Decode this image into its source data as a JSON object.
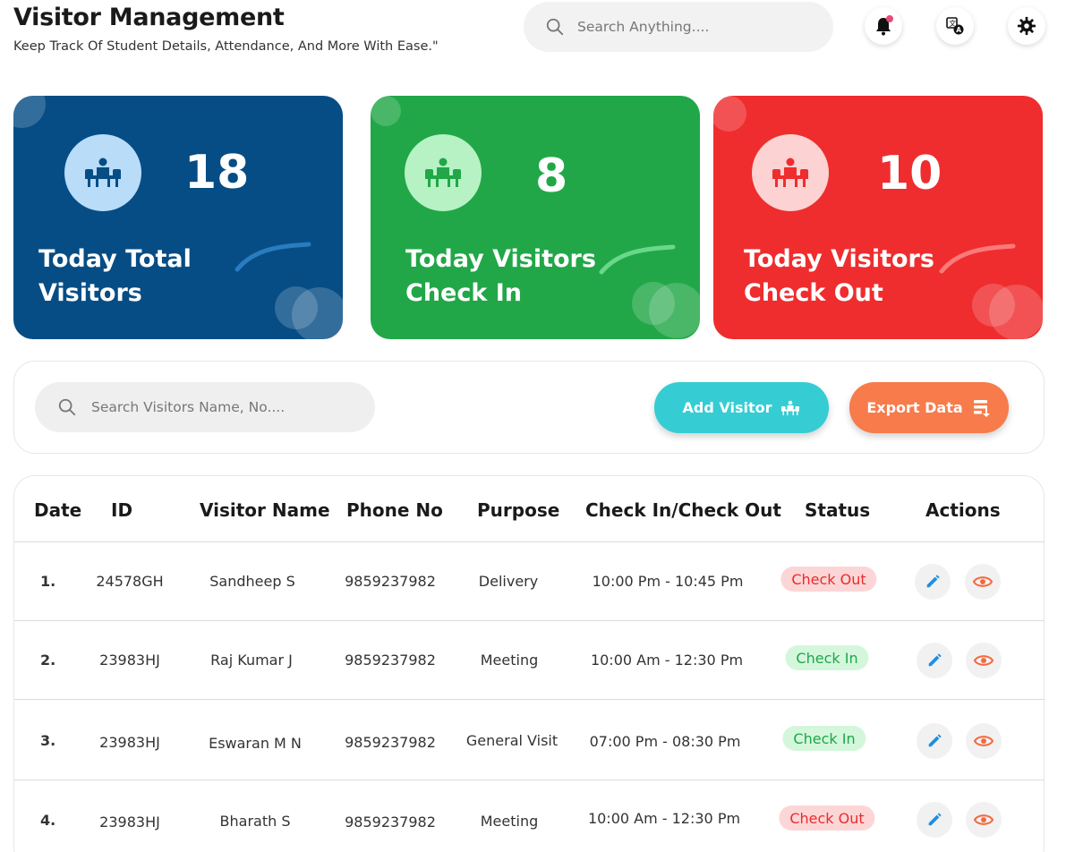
{
  "header": {
    "title": "Visitor Management",
    "subtitle": "Keep Track Of Student Details, Attendance, And More With Ease.\"",
    "search_placeholder": "Search Anything....",
    "icons": [
      "bell-icon",
      "translate-icon",
      "gear-icon"
    ]
  },
  "cards": [
    {
      "count": "18",
      "label": "Today Total Visitors",
      "color": "#064d85"
    },
    {
      "count": "8",
      "label": "Today Visitors Check In",
      "color": "#21a747"
    },
    {
      "count": "10",
      "label": "Today Visitors Check Out",
      "color": "#ef2d2e"
    }
  ],
  "toolbar": {
    "search_placeholder": "Search Visitors Name, No....",
    "add_label": "Add Visitor",
    "export_label": "Export Data",
    "add_color": "#35cdd3",
    "export_color": "#f77b4b"
  },
  "table": {
    "headers": [
      "Date",
      "ID",
      "Visitor Name",
      "Phone No",
      "Purpose",
      "Check In/Check Out",
      "Status",
      "Actions"
    ],
    "rows": [
      {
        "num": "1.",
        "id": "24578GH",
        "name": "Sandheep S",
        "phone": "9859237982",
        "purpose": "Delivery",
        "time": "10:00 Pm - 10:45 Pm",
        "status": "Check  Out"
      },
      {
        "num": "2.",
        "id": "23983HJ",
        "name": "Raj Kumar J",
        "phone": "9859237982",
        "purpose": "Meeting",
        "time": "10:00 Am - 12:30 Pm",
        "status": "Check In"
      },
      {
        "num": "3.",
        "id": "23983HJ",
        "name": "Eswaran M N",
        "phone": "9859237982",
        "purpose": "General Visit",
        "time": "07:00 Pm - 08:30 Pm",
        "status": "Check In"
      },
      {
        "num": "4.",
        "id": "23983HJ",
        "name": "Bharath S",
        "phone": "9859237982",
        "purpose": "Meeting",
        "time": "10:00 Am - 12:30 Pm",
        "status": "Check  Out"
      }
    ]
  }
}
